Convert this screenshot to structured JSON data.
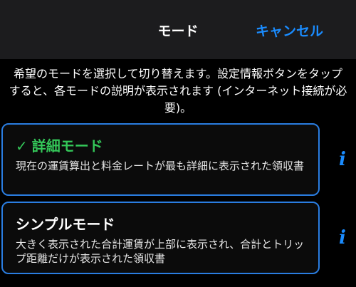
{
  "navbar": {
    "title": "モード",
    "cancel_label": "キャンセル"
  },
  "description": "希望のモードを選択して切り替えます。設定情報ボタンをタップすると、各モードの説明が表示されます (インターネット接続が必要)。",
  "modes": [
    {
      "title": "詳細モード",
      "selected": true,
      "check": "✓",
      "description": "現在の運賃算出と料金レートが最も詳細に表示された領収書"
    },
    {
      "title": "シンプルモード",
      "selected": false,
      "description": "大きく表示された合計運賃が上部に表示され、合計とトリップ距離だけが表示された領収書"
    }
  ],
  "info_button_glyph": "i",
  "colors": {
    "accent": "#1a8cff",
    "selected_title": "#34c759",
    "card_border": "#2a7de1"
  }
}
